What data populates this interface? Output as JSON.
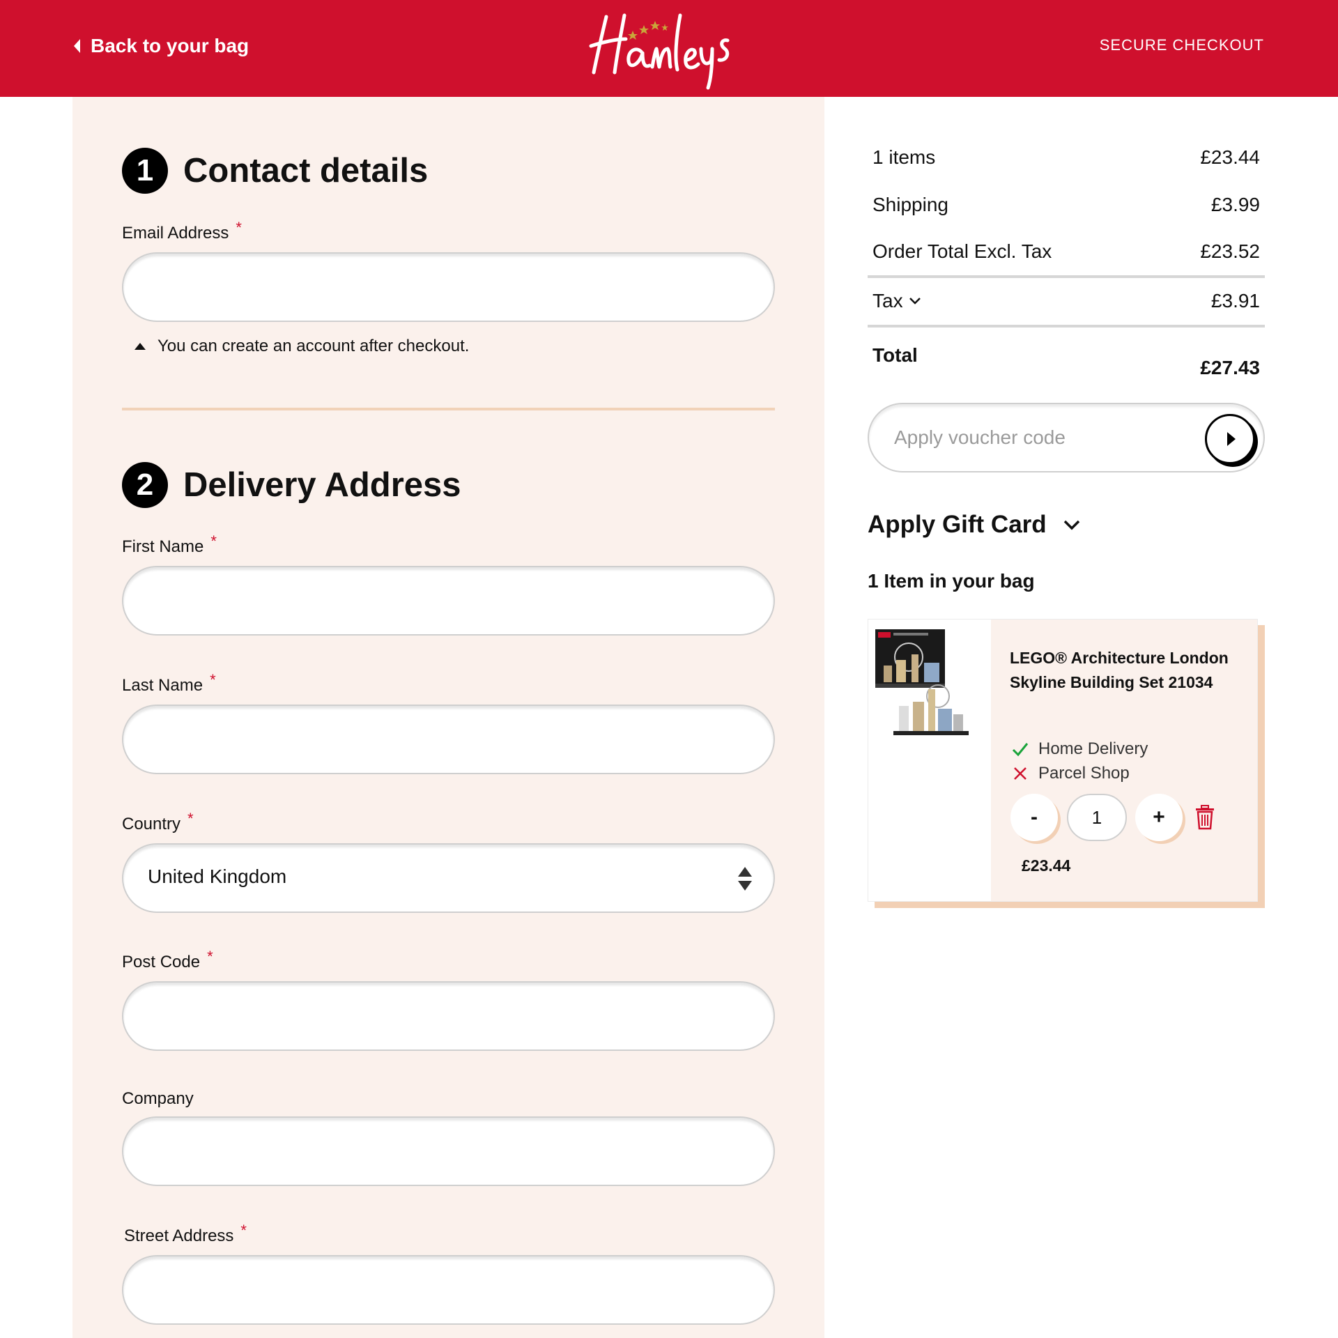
{
  "header": {
    "back_label": "Back to your bag",
    "logo_text": "Hamleys",
    "secure_label": "SECURE CHECKOUT",
    "brand_color": "#cf102d"
  },
  "contact": {
    "step": "1",
    "title": "Contact details",
    "email_label": "Email Address",
    "email_value": "",
    "hint": "You can create an account after checkout."
  },
  "delivery": {
    "step": "2",
    "title": "Delivery Address",
    "first_name_label": "First Name",
    "last_name_label": "Last Name",
    "country_label": "Country",
    "country_value": "United Kingdom",
    "postcode_label": "Post Code",
    "company_label": "Company",
    "street_label": "Street Address",
    "required_mark": "*"
  },
  "summary": {
    "items_label": "1 items",
    "items_value": "£23.44",
    "shipping_label": "Shipping",
    "shipping_value": "£3.99",
    "excl_label": "Order Total Excl. Tax",
    "excl_value": "£23.52",
    "tax_label": "Tax",
    "tax_value": "£3.91",
    "total_label": "Total",
    "total_value": "£27.43",
    "voucher_placeholder": "Apply voucher code",
    "giftcard_label": "Apply Gift Card",
    "bag_count_label": "1 Item in your bag"
  },
  "bag_item": {
    "title": "LEGO® Architecture London Skyline Building Set 21034",
    "home_delivery": "Home Delivery",
    "parcel_shop": "Parcel Shop",
    "qty_minus": "-",
    "qty": "1",
    "qty_plus": "+",
    "price": "£23.44",
    "home_delivery_available": true,
    "parcel_shop_available": false
  }
}
